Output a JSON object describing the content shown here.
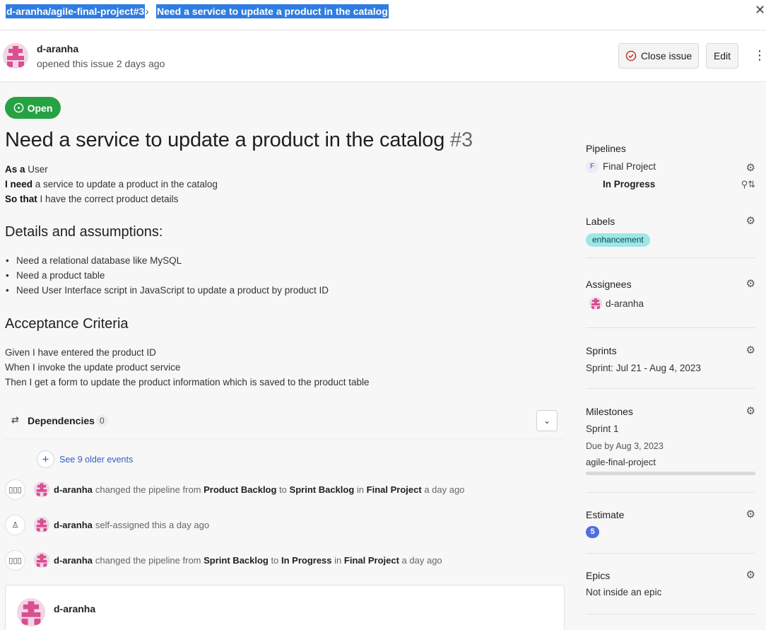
{
  "breadcrumb": {
    "repo": "d-aranha/agile-final-project#3",
    "title": "Need a service to update a product in the catalog"
  },
  "header": {
    "author": "d-aranha",
    "meta": "opened this issue 2 days ago",
    "close_label": "Close issue",
    "edit_label": "Edit"
  },
  "issue": {
    "status": "Open",
    "title": "Need a service to update a product in the catalog",
    "number": "#3",
    "story": [
      {
        "bold": "As a",
        "text": " User"
      },
      {
        "bold": "I need",
        "text": " a service to update a product in the catalog"
      },
      {
        "bold": "So that",
        "text": " I have the correct product details"
      }
    ],
    "details_heading": "Details and assumptions:",
    "details": [
      "Need a relational database like MySQL",
      "Need a product table",
      "Need User Interface script in JavaScript to update a product by product ID"
    ],
    "criteria_heading": "Acceptance Criteria",
    "criteria": [
      "Given I have entered the product ID",
      "When I invoke the update product service",
      "Then I get a form to update the product information which is saved to the product table"
    ]
  },
  "dependencies": {
    "label": "Dependencies",
    "count": "0"
  },
  "timeline": {
    "older": "See 9 older events",
    "events": [
      {
        "who": "d-aranha",
        "t1": "changed the pipeline from",
        "b1": "Product Backlog",
        "t2": "to",
        "b2": "Sprint Backlog",
        "t3": "in",
        "b3": "Final Project",
        "t4": "a day ago"
      },
      {
        "who": "d-aranha",
        "t1": "self-assigned this a day ago"
      },
      {
        "who": "d-aranha",
        "t1": "changed the pipeline from",
        "b1": "Sprint Backlog",
        "t2": "to",
        "b2": "In Progress",
        "t3": "in",
        "b3": "Final Project",
        "t4": "a day ago"
      }
    ],
    "comment_author": "d-aranha"
  },
  "sidebar": {
    "pipelines": {
      "title": "Pipelines",
      "badge": "F",
      "project": "Final Project",
      "stage": "In Progress"
    },
    "labels": {
      "title": "Labels",
      "chip": "enhancement"
    },
    "assignees": {
      "title": "Assignees",
      "name": "d-aranha"
    },
    "sprints": {
      "title": "Sprints",
      "value": "Sprint: Jul 21 - Aug 4, 2023"
    },
    "milestones": {
      "title": "Milestones",
      "name": "Sprint 1",
      "due": "Due by Aug 3, 2023",
      "repo": "agile-final-project",
      "progress": 0
    },
    "estimate": {
      "title": "Estimate",
      "value": "5"
    },
    "epics": {
      "title": "Epics",
      "value": "Not inside an epic"
    }
  },
  "colors": {
    "accent": "#2f7de1",
    "open_green": "#27a243",
    "label_cyan": "#9ee6e8",
    "estimate_blue": "#4f6ee0",
    "avatar_pink": "#d94f8f"
  }
}
